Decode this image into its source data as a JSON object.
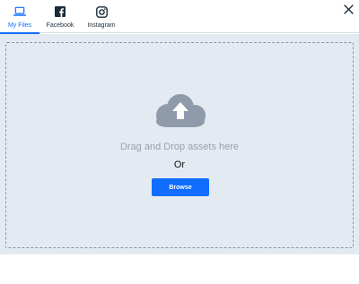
{
  "tabs": [
    {
      "label": "My Files",
      "icon": "laptop-icon",
      "active": true
    },
    {
      "label": "Facebook",
      "icon": "facebook-icon",
      "active": false
    },
    {
      "label": "Instagram",
      "icon": "instagram-icon",
      "active": false
    }
  ],
  "close": {
    "icon": "close-icon"
  },
  "dropzone": {
    "icon": "cloud-upload-icon",
    "text": "Drag and Drop assets here",
    "or_text": "Or",
    "browse_label": "Browse"
  },
  "colors": {
    "accent": "#116dff",
    "dropzone_background": "#e4eaf1",
    "dropzone_border": "#8c97a3",
    "cloud": "#8f9bab",
    "muted_text": "#98a2ad"
  }
}
